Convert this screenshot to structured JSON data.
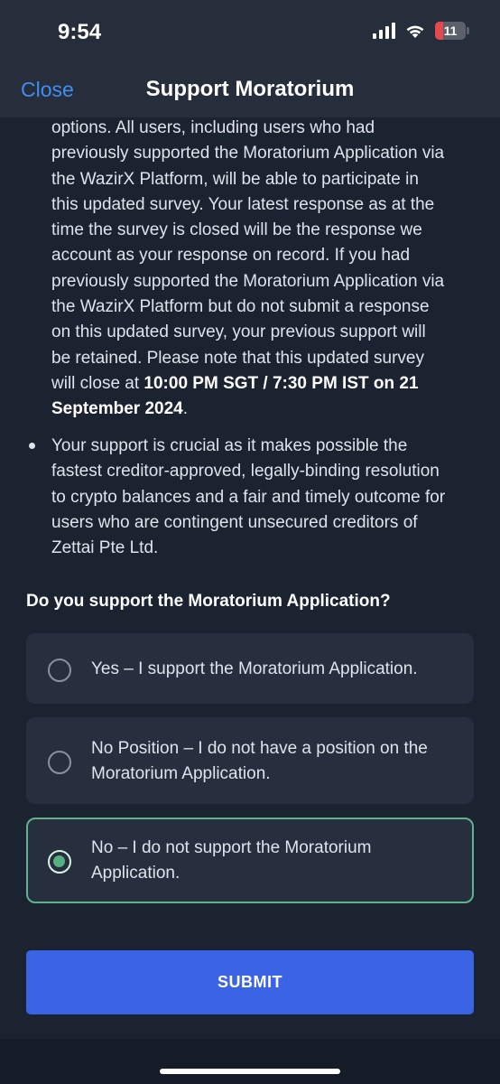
{
  "status_bar": {
    "time": "9:54",
    "battery_level": "11",
    "icons": [
      "cellular-signal-icon",
      "wifi-icon",
      "battery-icon"
    ]
  },
  "nav": {
    "close_label": "Close",
    "title": "Support Moratorium"
  },
  "paragraph1": {
    "lines": [
      "options. All users, including users who had",
      "previously supported the Moratorium Application via",
      "the WazirX Platform, will be able to participate in",
      "this updated survey. Your latest response as at the",
      "time the survey is closed will be the response we",
      "account as your response on record. If you had",
      "previously supported the Moratorium Application via",
      "the WazirX Platform but do not submit a response",
      "on this updated survey, your previous support will",
      "be retained. Please note that this updated survey"
    ],
    "line11_prefix": "will close at ",
    "line11_bold": "10:00 PM SGT / 7:30 PM IST on 21",
    "line12_bold": "September 2024",
    "line12_suffix": "."
  },
  "paragraph2": {
    "lines": [
      "Your support is crucial as it makes possible the",
      "fastest creditor-approved, legally-binding resolution",
      "to crypto balances and a fair and timely outcome for",
      "users who are contingent unsecured creditors of",
      "Zettai Pte Ltd."
    ]
  },
  "question": "Do you support the Moratorium Application?",
  "options": [
    {
      "lines": [
        "Yes – I support the Moratorium Application."
      ],
      "selected": false
    },
    {
      "lines": [
        "No Position – I do not have a position on the",
        "Moratorium Application."
      ],
      "selected": false
    },
    {
      "lines": [
        "No – I do not support the Moratorium",
        "Application."
      ],
      "selected": true
    }
  ],
  "submit_label": "SUBMIT",
  "colors": {
    "accent_link": "#3f8ef0",
    "submit_button": "#3a63e6",
    "selected_border": "#5fb38a",
    "background": "#1b2230"
  }
}
